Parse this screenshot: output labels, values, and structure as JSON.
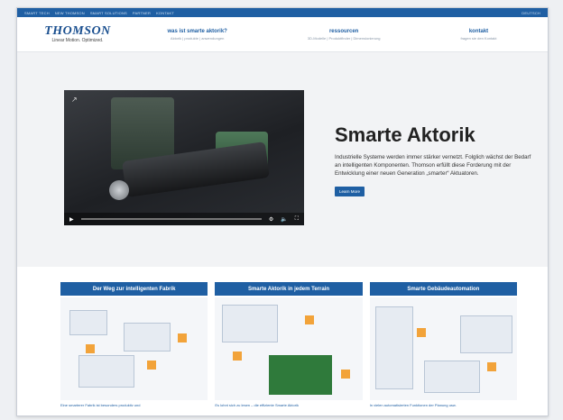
{
  "topbar": {
    "left_links": [
      "smart tech",
      "new thomson",
      "smart solutions",
      "partner",
      "kontakt"
    ],
    "right_label": "deutsch"
  },
  "logo": {
    "brand": "THOMSON",
    "tagline": "Linear Motion. Optimized."
  },
  "nav": [
    {
      "title": "was ist smarte aktorik?",
      "subtitle": "Aktorik | produkte | anwendungen"
    },
    {
      "title": "ressourcen",
      "subtitle": "3D-Modelle | Produktfinder | Dimensionierung"
    },
    {
      "title": "kontakt",
      "subtitle": "fragen sie den Kontakt"
    }
  ],
  "hero": {
    "title": "Smarte Aktorik",
    "body": "Industrielle Systeme werden immer stärker vernetzt. Folglich wächst der Bedarf an intelligenten Komponenten. Thomson erfüllt diese Forderung mit der Entwicklung einer neuen Generation „smarter“ Aktuatoren.",
    "button": "Learn More"
  },
  "cards": [
    {
      "title": "Der Weg zur intelligenten Fabrik",
      "caption": "Eine smarterer Fabrik ist besonders produktiv und"
    },
    {
      "title": "Smarte Aktorik in jedem Terrain",
      "caption": "Es lohnt sich zu lesen – die effiziente Smarte Aktorik"
    },
    {
      "title": "Smarte Gebäudeautomation",
      "caption": "In vielen automatisierten Funktionen der Planung usw."
    }
  ],
  "icons": [
    "share-icon",
    "play-icon",
    "settings-icon",
    "volume-icon",
    "fullscreen-icon"
  ],
  "colors": {
    "brand_blue": "#1f5fa3",
    "accent_orange": "#f2a33a"
  }
}
